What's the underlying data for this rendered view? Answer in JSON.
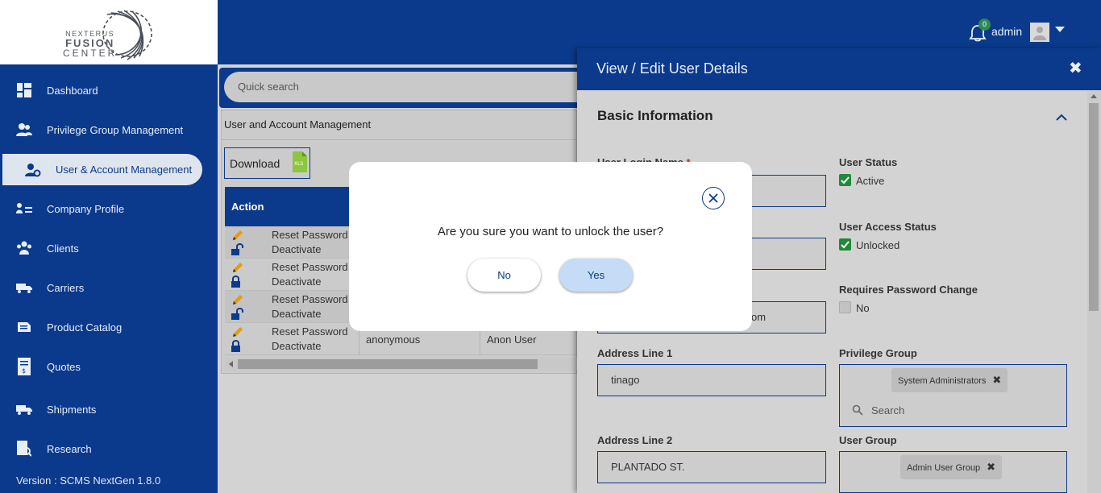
{
  "logo": {
    "line1": "NEXTERUS",
    "line2": "FUSION",
    "line3": "CENTER"
  },
  "sidebar": {
    "items": [
      {
        "label": "Dashboard",
        "icon": "dashboard-icon"
      },
      {
        "label": "Privilege Group Management",
        "icon": "users-group-icon"
      },
      {
        "label": "User & Account Management",
        "icon": "user-settings-icon",
        "active": true
      },
      {
        "label": "Company Profile",
        "icon": "company-profile-icon"
      },
      {
        "label": "Clients",
        "icon": "clients-icon"
      },
      {
        "label": "Carriers",
        "icon": "carriers-icon"
      },
      {
        "label": "Product Catalog",
        "icon": "product-catalog-icon"
      },
      {
        "label": "Quotes",
        "icon": "quotes-icon"
      },
      {
        "label": "Shipments",
        "icon": "shipments-icon"
      },
      {
        "label": "Research",
        "icon": "research-icon"
      }
    ],
    "version": "Version : SCMS NextGen 1.8.0"
  },
  "header": {
    "notification_count": "0",
    "username": "admin"
  },
  "main": {
    "search_placeholder": "Quick search",
    "card_title": "User and Account Management",
    "download_label": "Download",
    "xls_label": "XLS",
    "table": {
      "action_header": "Action",
      "rows": [
        {
          "reset": "Reset Password",
          "deactivate": "Deactivate",
          "lock": "unlocked",
          "col2": "",
          "col3": ""
        },
        {
          "reset": "Reset Password",
          "deactivate": "Deactivate",
          "lock": "locked",
          "col2": "",
          "col3": ""
        },
        {
          "reset": "Reset Password",
          "deactivate": "Deactivate",
          "lock": "unlocked",
          "col2": "",
          "col3": ""
        },
        {
          "reset": "Reset Password",
          "deactivate": "Deactivate",
          "lock": "locked",
          "col2": "anonymous",
          "col3": "Anon User"
        }
      ]
    }
  },
  "panel": {
    "title": "View / Edit User Details",
    "section": "Basic Information",
    "fields": {
      "login_name_label": "User Login Name",
      "required_mark": "*",
      "email_partial": "om",
      "address1_label": "Address Line 1",
      "address1_value": "tinago",
      "address2_label": "Address Line 2",
      "address2_value": "PLANTADO ST.",
      "user_status_label": "User Status",
      "user_status_value": "Active",
      "access_status_label": "User Access Status",
      "access_status_value": "Unlocked",
      "pw_change_label": "Requires Password Change",
      "pw_change_value": "No",
      "privilege_group_label": "Privilege Group",
      "privilege_group_chip": "System Administrators",
      "privilege_search_placeholder": "Search",
      "user_group_label": "User Group",
      "user_group_chip": "Admin User Group"
    }
  },
  "dialog": {
    "message": "Are you sure you want to unlock the user?",
    "no_label": "No",
    "yes_label": "Yes"
  },
  "colors": {
    "primary": "#0b3a8c",
    "success": "#1f8a3a",
    "yes_button": "#c6dbf5"
  }
}
